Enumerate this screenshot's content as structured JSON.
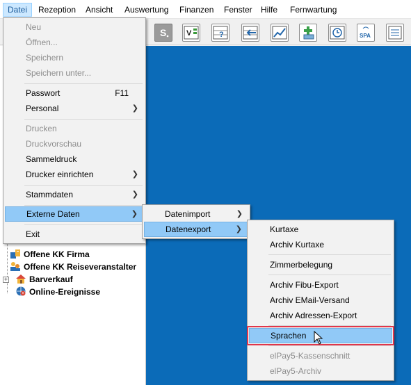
{
  "menubar": {
    "items": [
      "Datei",
      "Rezeption",
      "Ansicht",
      "Auswertung",
      "Finanzen",
      "Fenster",
      "Hilfe",
      "Fernwartung"
    ]
  },
  "toolbar": {
    "buttons": [
      "s-icon",
      "v-icon",
      "query-grid-icon",
      "import-arrow-icon",
      "line-chart-icon",
      "add-building-icon",
      "clock-icon",
      "spa-icon",
      "document-list-icon"
    ]
  },
  "datei_menu": {
    "items": [
      {
        "label": "Neu",
        "enabled": false
      },
      {
        "label": "Öffnen...",
        "enabled": false
      },
      {
        "label": "Speichern",
        "enabled": false
      },
      {
        "label": "Speichern unter...",
        "enabled": false
      },
      {
        "label": "Passwort",
        "shortcut": "F11",
        "enabled": true
      },
      {
        "label": "Personal",
        "submenu": true,
        "enabled": true
      },
      {
        "label": "Drucken",
        "enabled": false
      },
      {
        "label": "Druckvorschau",
        "enabled": false
      },
      {
        "label": "Sammeldruck",
        "enabled": true
      },
      {
        "label": "Drucker einrichten",
        "submenu": true,
        "enabled": true
      },
      {
        "label": "Stammdaten",
        "submenu": true,
        "enabled": true
      },
      {
        "label": "Externe Daten",
        "submenu": true,
        "enabled": true,
        "highlighted": true
      },
      {
        "label": "Exit",
        "enabled": true
      }
    ]
  },
  "externe_menu": {
    "items": [
      {
        "label": "Datenimport",
        "submenu": true
      },
      {
        "label": "Datenexport",
        "submenu": true,
        "highlighted": true
      }
    ]
  },
  "export_menu": {
    "items": [
      {
        "label": "Kurtaxe",
        "enabled": true
      },
      {
        "label": "Archiv Kurtaxe",
        "enabled": true
      },
      {
        "label": "Zimmerbelegung",
        "enabled": true
      },
      {
        "label": "Archiv Fibu-Export",
        "enabled": true
      },
      {
        "label": "Archiv EMail-Versand",
        "enabled": true
      },
      {
        "label": "Archiv Adressen-Export",
        "enabled": true
      },
      {
        "label": "Sprachen",
        "enabled": true,
        "highlighted": true
      },
      {
        "label": "elPay5-Kassenschnitt",
        "enabled": false
      },
      {
        "label": "elPay5-Archiv",
        "enabled": false
      }
    ]
  },
  "tree": {
    "items": [
      {
        "label": "Offene KK Firma",
        "icon": "company-invoice-icon"
      },
      {
        "label": "Offene KK Reiseveranstalter",
        "icon": "travel-agency-icon"
      },
      {
        "label": "Barverkauf",
        "icon": "house-icon"
      },
      {
        "label": "Online-Ereignisse",
        "icon": "online-events-icon"
      }
    ]
  },
  "colors": {
    "workspace": "#0b6bb8",
    "highlight": "#91c9f7",
    "annotation": "#e0364a"
  }
}
